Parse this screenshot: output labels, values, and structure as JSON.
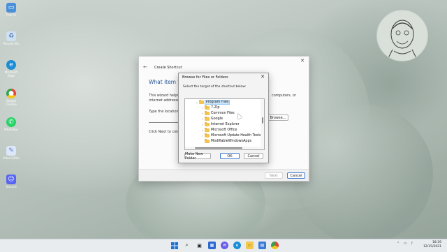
{
  "desktop": {
    "icons": [
      {
        "label": "This PC",
        "icon": "computer-icon",
        "color": "#4a90d9"
      },
      {
        "label": "Recycle Bin",
        "icon": "recycle-bin-icon",
        "color": "#7ea9d6"
      },
      {
        "label": "Microsoft Edge",
        "icon": "edge-icon",
        "color": "#1b8fd6"
      },
      {
        "label": "Google Chrome",
        "icon": "chrome-icon",
        "color": "#e2453c"
      },
      {
        "label": "WhatsApp",
        "icon": "whatsapp-icon",
        "color": "#25d366"
      },
      {
        "label": "Video Editor",
        "icon": "video-editor-icon",
        "color": "#5a7fd6"
      },
      {
        "label": "Discord",
        "icon": "discord-icon",
        "color": "#5865f2"
      }
    ]
  },
  "wizard": {
    "title": "Create Shortcut",
    "heading": "What item wou",
    "desc_line1": "This wizard helps you",
    "desc_line1_right": "computers, or",
    "desc_line2": "internet addresses.",
    "location_label": "Type the location of",
    "next_hint": "Click Next to continue",
    "browse_label": "Browse...",
    "next_label": "Next",
    "cancel_label": "Cancel"
  },
  "browse_dialog": {
    "title": "Browse for Files or Folders",
    "description": "Select the target of the shortcut below:",
    "tree": [
      {
        "label": "Program Files",
        "level": 0,
        "expanded": true,
        "selected": true
      },
      {
        "label": "7-Zip",
        "level": 1
      },
      {
        "label": "Common Files",
        "level": 1
      },
      {
        "label": "Google",
        "level": 1
      },
      {
        "label": "Internet Explorer",
        "level": 1
      },
      {
        "label": "Microsoft Office",
        "level": 1
      },
      {
        "label": "Microsoft Update Health Tools",
        "level": 1
      },
      {
        "label": "ModifiableWindowsApps",
        "level": 1
      }
    ],
    "make_new_folder_label": "Make New Folder",
    "ok_label": "OK",
    "cancel_label": "Cancel"
  },
  "taskbar": {
    "apps": [
      "windows-start-icon",
      "search-icon",
      "task-view-icon",
      "widgets-icon",
      "chat-icon",
      "edge-icon",
      "file-explorer-icon",
      "store-icon",
      "chrome-icon"
    ],
    "clock_time": "18:39",
    "clock_date": "12/15/2021"
  },
  "colors": {
    "accent": "#1d4f91",
    "selection": "#cce4f7",
    "folder": "#f1c453"
  }
}
